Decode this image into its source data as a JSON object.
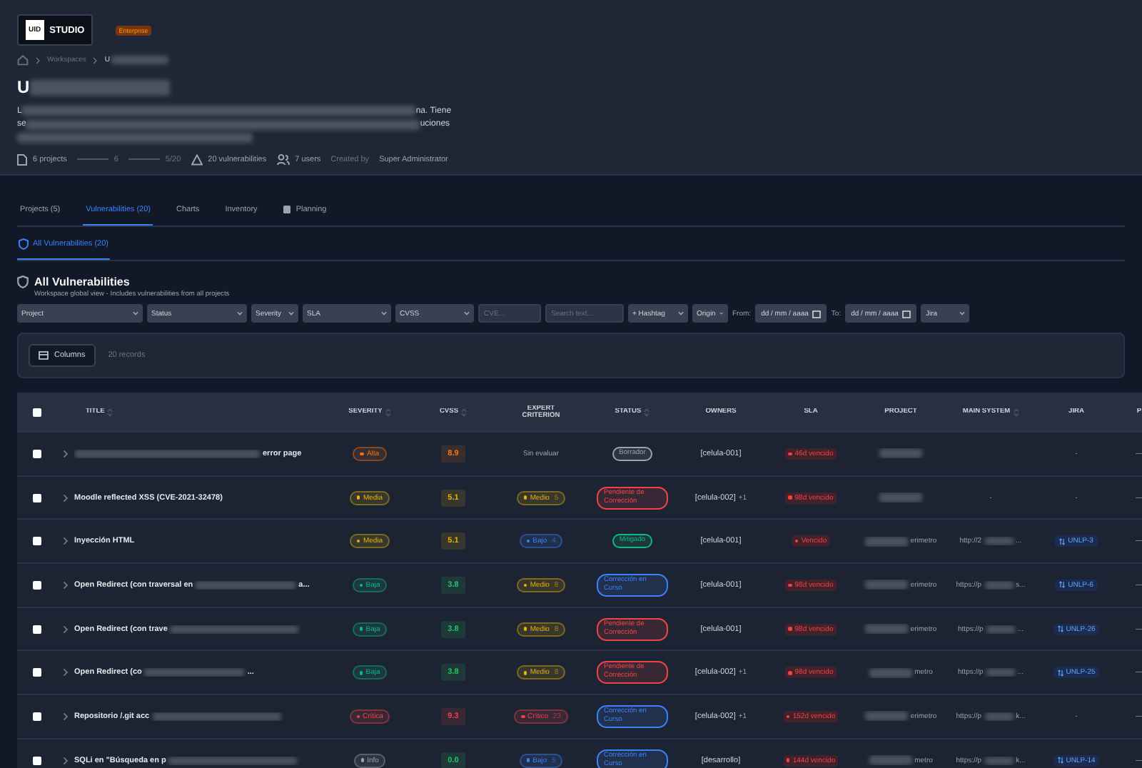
{
  "brand": {
    "logo_mark": "UID",
    "logo_text": "STUDIO",
    "plan": "Enterprise"
  },
  "breadcrumb": {
    "items": [
      "Workspaces"
    ],
    "current": "U"
  },
  "workspace": {
    "title": "U",
    "description": [
      {
        "head": "L",
        "tail": "na. Tiene"
      },
      {
        "head": "se",
        "tail": "uciones"
      }
    ]
  },
  "stats": {
    "projects": "6 projects",
    "bar_a": "6",
    "bar_b": "5/20",
    "vulnerabilities": "20 vulnerabilities",
    "users": "7 users",
    "created_label": "Created by",
    "created_by": "Super Administrator"
  },
  "tabs": [
    {
      "label": "Projects (5)",
      "selected": false
    },
    {
      "label": "Vulnerabilities (20)",
      "selected": true
    },
    {
      "label": "Charts",
      "selected": false
    },
    {
      "label": "Inventory",
      "selected": false
    },
    {
      "label": "Planning",
      "selected": false,
      "icon": true
    }
  ],
  "subtabs": [
    {
      "label": "All Vulnerabilities (20)",
      "selected": true
    }
  ],
  "section": {
    "title": "All Vulnerabilities",
    "subtitle": "Workspace global view - Includes vulnerabilities from all projects"
  },
  "filters": [
    {
      "kind": "select",
      "label": "Project"
    },
    {
      "kind": "select",
      "label": "Status"
    },
    {
      "kind": "select",
      "label": "Severity"
    },
    {
      "kind": "select",
      "label": "SLA"
    },
    {
      "kind": "select",
      "label": "CVSS"
    },
    {
      "kind": "input",
      "placeholder": "CVE..."
    },
    {
      "kind": "input",
      "placeholder": "Search text..."
    },
    {
      "kind": "select",
      "label": "+ Hashtag"
    },
    {
      "kind": "select",
      "label": "Origin"
    },
    {
      "kind": "date",
      "prefix": "From:",
      "placeholder": "dd / mm / aaaa"
    },
    {
      "kind": "date",
      "prefix": "To:",
      "placeholder": "dd / mm / aaaa"
    },
    {
      "kind": "select",
      "label": "Jira"
    }
  ],
  "toolbar": {
    "columns_button": "Columns",
    "records": "20 records"
  },
  "table": {
    "select_all": {
      "checked": false
    },
    "columns": [
      {
        "label": "TITLE",
        "sortable": true
      },
      {
        "label": "SEVERITY",
        "sortable": true
      },
      {
        "label": "CVSS",
        "sortable": true
      },
      {
        "label": "EXPERT CRITERION",
        "sortable": false
      },
      {
        "label": "STATUS",
        "sortable": true
      },
      {
        "label": "OWNERS",
        "sortable": false
      },
      {
        "label": "SLA",
        "sortable": false
      },
      {
        "label": "PROJECT",
        "sortable": false
      },
      {
        "label": "MAIN SYSTEM",
        "sortable": true
      },
      {
        "label": "JIRA",
        "sortable": false
      },
      {
        "label": "P",
        "sortable": false
      }
    ],
    "rows": [
      {
        "checked": false,
        "title": {
          "redacted": true,
          "tail": "error page"
        },
        "severity": {
          "label": "Alta",
          "color": "#f97316"
        },
        "cvss": {
          "value": "8.9",
          "color": "#f97316"
        },
        "expert": {
          "kind": "text",
          "label": "Sin evaluar"
        },
        "status": {
          "label": "Borrador",
          "color": "#9ca3af"
        },
        "owners": {
          "name": "[celula-001]"
        },
        "sla": "46d vencido",
        "project": {},
        "jira": {
          "kind": "none",
          "label": "-"
        },
        "column_11": "—"
      },
      {
        "checked": false,
        "title": {
          "head": "Moodle reflected XSS (CVE-2021-32478)",
          "redacted": false
        },
        "severity": {
          "label": "Media",
          "color": "#eab308"
        },
        "cvss": {
          "value": "5.1",
          "color": "#eab308"
        },
        "expert": {
          "kind": "pill",
          "label": "Medio",
          "count": "5",
          "color": "#eab308"
        },
        "status": {
          "label": "Pendiente de Corrección",
          "color": "#ef4444"
        },
        "owners": {
          "name": "[celula-002]",
          "extra": "+1"
        },
        "sla": "98d vencido",
        "project": {},
        "main_system": {
          "kind": "plain",
          "head": "-"
        },
        "jira": {
          "kind": "none",
          "label": "-"
        },
        "column_11": "—"
      },
      {
        "checked": false,
        "title": {
          "head": "Inyección HTML",
          "redacted": false
        },
        "severity": {
          "label": "Media",
          "color": "#eab308"
        },
        "cvss": {
          "value": "5.1",
          "color": "#eab308"
        },
        "expert": {
          "kind": "pill",
          "label": "Bajo",
          "count": "4",
          "color": "#3b82f6"
        },
        "status": {
          "label": "Mitigado",
          "color": "#10b981"
        },
        "owners": {
          "name": "[celula-001]"
        },
        "sla": "Vencido",
        "project": {
          "tail": "erimetro"
        },
        "main_system": {
          "kind": "url",
          "head": "http://2",
          "tail": "..."
        },
        "jira": {
          "kind": "link",
          "label": "UNLP-3"
        },
        "column_11": "—"
      },
      {
        "checked": false,
        "title": {
          "head": "Open Redirect (con traversal en",
          "redacted": true,
          "tail": "a..."
        },
        "severity": {
          "label": "Baja",
          "color": "#10b981"
        },
        "cvss": {
          "value": "3.8",
          "color": "#22c55e"
        },
        "expert": {
          "kind": "pill",
          "label": "Medio",
          "count": "8",
          "color": "#eab308"
        },
        "status": {
          "label": "Corrección en Curso",
          "color": "#3b82f6"
        },
        "owners": {
          "name": "[celula-001]"
        },
        "sla": "98d vencido",
        "project": {
          "tail": "erimetro"
        },
        "main_system": {
          "kind": "url",
          "head": "https://p",
          "tail": "s..."
        },
        "jira": {
          "kind": "link",
          "label": "UNLP-6"
        },
        "column_11": "—"
      },
      {
        "checked": false,
        "title": {
          "head": "Open Redirect (con trave",
          "redacted": true
        },
        "severity": {
          "label": "Baja",
          "color": "#10b981"
        },
        "cvss": {
          "value": "3.8",
          "color": "#22c55e"
        },
        "expert": {
          "kind": "pill",
          "label": "Medio",
          "count": "8",
          "color": "#eab308"
        },
        "status": {
          "label": "Pendiente de Corrección",
          "color": "#ef4444"
        },
        "owners": {
          "name": "[celula-001]"
        },
        "sla": "98d vencido",
        "project": {
          "tail": "erimetro"
        },
        "main_system": {
          "kind": "url",
          "head": "https://p",
          "tail": "..."
        },
        "jira": {
          "kind": "link",
          "label": "UNLP-26"
        },
        "column_11": "—"
      },
      {
        "checked": false,
        "title": {
          "head": "Open Redirect (co",
          "redacted": true,
          "tail": "..."
        },
        "severity": {
          "label": "Baja",
          "color": "#10b981"
        },
        "cvss": {
          "value": "3.8",
          "color": "#22c55e"
        },
        "expert": {
          "kind": "pill",
          "label": "Medio",
          "count": "8",
          "color": "#eab308"
        },
        "status": {
          "label": "Pendiente de Corrección",
          "color": "#ef4444"
        },
        "owners": {
          "name": "[celula-002]",
          "extra": "+1"
        },
        "sla": "98d vencido",
        "project": {
          "tail": "metro"
        },
        "main_system": {
          "kind": "url",
          "head": "https://p",
          "tail": "..."
        },
        "jira": {
          "kind": "link",
          "label": "UNLP-25"
        },
        "column_11": "—"
      },
      {
        "checked": false,
        "title": {
          "head": "Repositorio /.git acc",
          "redacted": true
        },
        "severity": {
          "label": "Crítica",
          "color": "#ef4444"
        },
        "cvss": {
          "value": "9.3",
          "color": "#ef4444"
        },
        "expert": {
          "kind": "pill",
          "label": "Crítico",
          "count": "23",
          "color": "#ef4444"
        },
        "status": {
          "label": "Corrección en Curso",
          "color": "#3b82f6"
        },
        "owners": {
          "name": "[celula-002]",
          "extra": "+1"
        },
        "sla": "152d vencido",
        "project": {
          "tail": "erimetro"
        },
        "main_system": {
          "kind": "url",
          "head": "https://p",
          "tail": "k..."
        },
        "jira": {
          "kind": "none",
          "label": "-"
        },
        "column_11": "—"
      },
      {
        "checked": false,
        "title": {
          "head": "SQLi en \"Búsqueda en p",
          "redacted": true
        },
        "severity": {
          "label": "Info",
          "color": "#9ca3af"
        },
        "cvss": {
          "value": "0.0",
          "color": "#22c55e"
        },
        "expert": {
          "kind": "pill",
          "label": "Bajo",
          "count": "5",
          "color": "#3b82f6"
        },
        "status": {
          "label": "Corrección en Curso",
          "color": "#3b82f6"
        },
        "owners": {
          "name": "[desarrollo]"
        },
        "sla": "144d vencido",
        "project": {
          "tail": "metro"
        },
        "main_system": {
          "kind": "url",
          "head": "https://p",
          "tail": "k..."
        },
        "jira": {
          "kind": "link",
          "label": "UNLP-14"
        },
        "column_11": "—"
      }
    ]
  }
}
